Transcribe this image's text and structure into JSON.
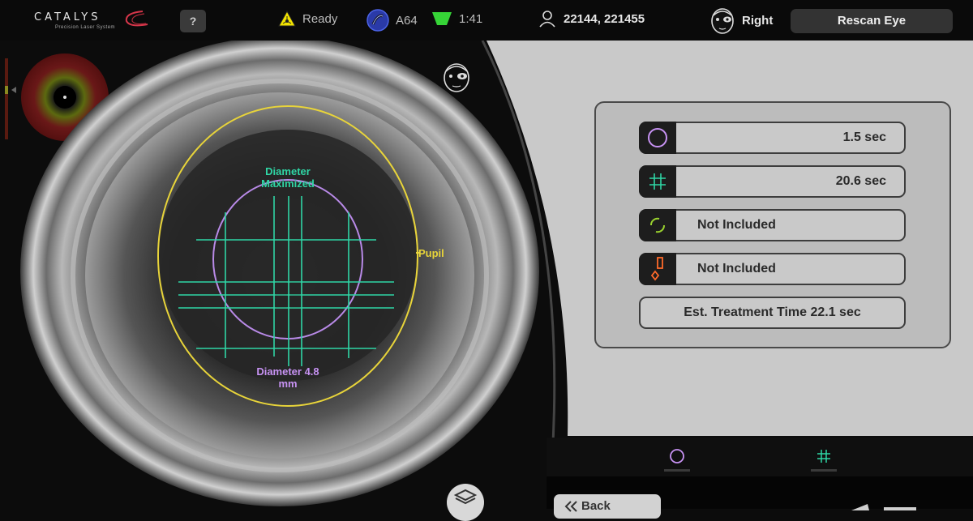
{
  "header": {
    "logo_name": "CATALYS",
    "logo_sub": "Precision Laser System",
    "help_label": "?",
    "status_text": "Ready",
    "lens_code": "A64",
    "timer": "1:41",
    "patient_ids": "22144, 221455",
    "eye_side": "Right",
    "rescan_label": "Rescan Eye"
  },
  "eye_view": {
    "label_diameter_max": "Diameter Maximized",
    "label_pupil": "Pupil",
    "label_diameter_value": "Diameter 4.8 mm"
  },
  "treatment": {
    "rows": [
      {
        "icon": "capsulotomy-circle-icon",
        "value": "1.5 sec"
      },
      {
        "icon": "lens-fragmentation-grid-icon",
        "value": "20.6 sec"
      },
      {
        "icon": "arcuate-incision-icon",
        "value": "Not Included"
      },
      {
        "icon": "corneal-incision-icon",
        "value": "Not Included"
      }
    ],
    "estimate": "Est. Treatment Time 22.1 sec"
  },
  "bottom": {
    "back_label": "Back"
  },
  "colors": {
    "accent_green": "#2fd6a5",
    "accent_purple": "#c792f3",
    "pupil_yellow": "#e8d43a",
    "incision_orange": "#ff6a2a"
  }
}
